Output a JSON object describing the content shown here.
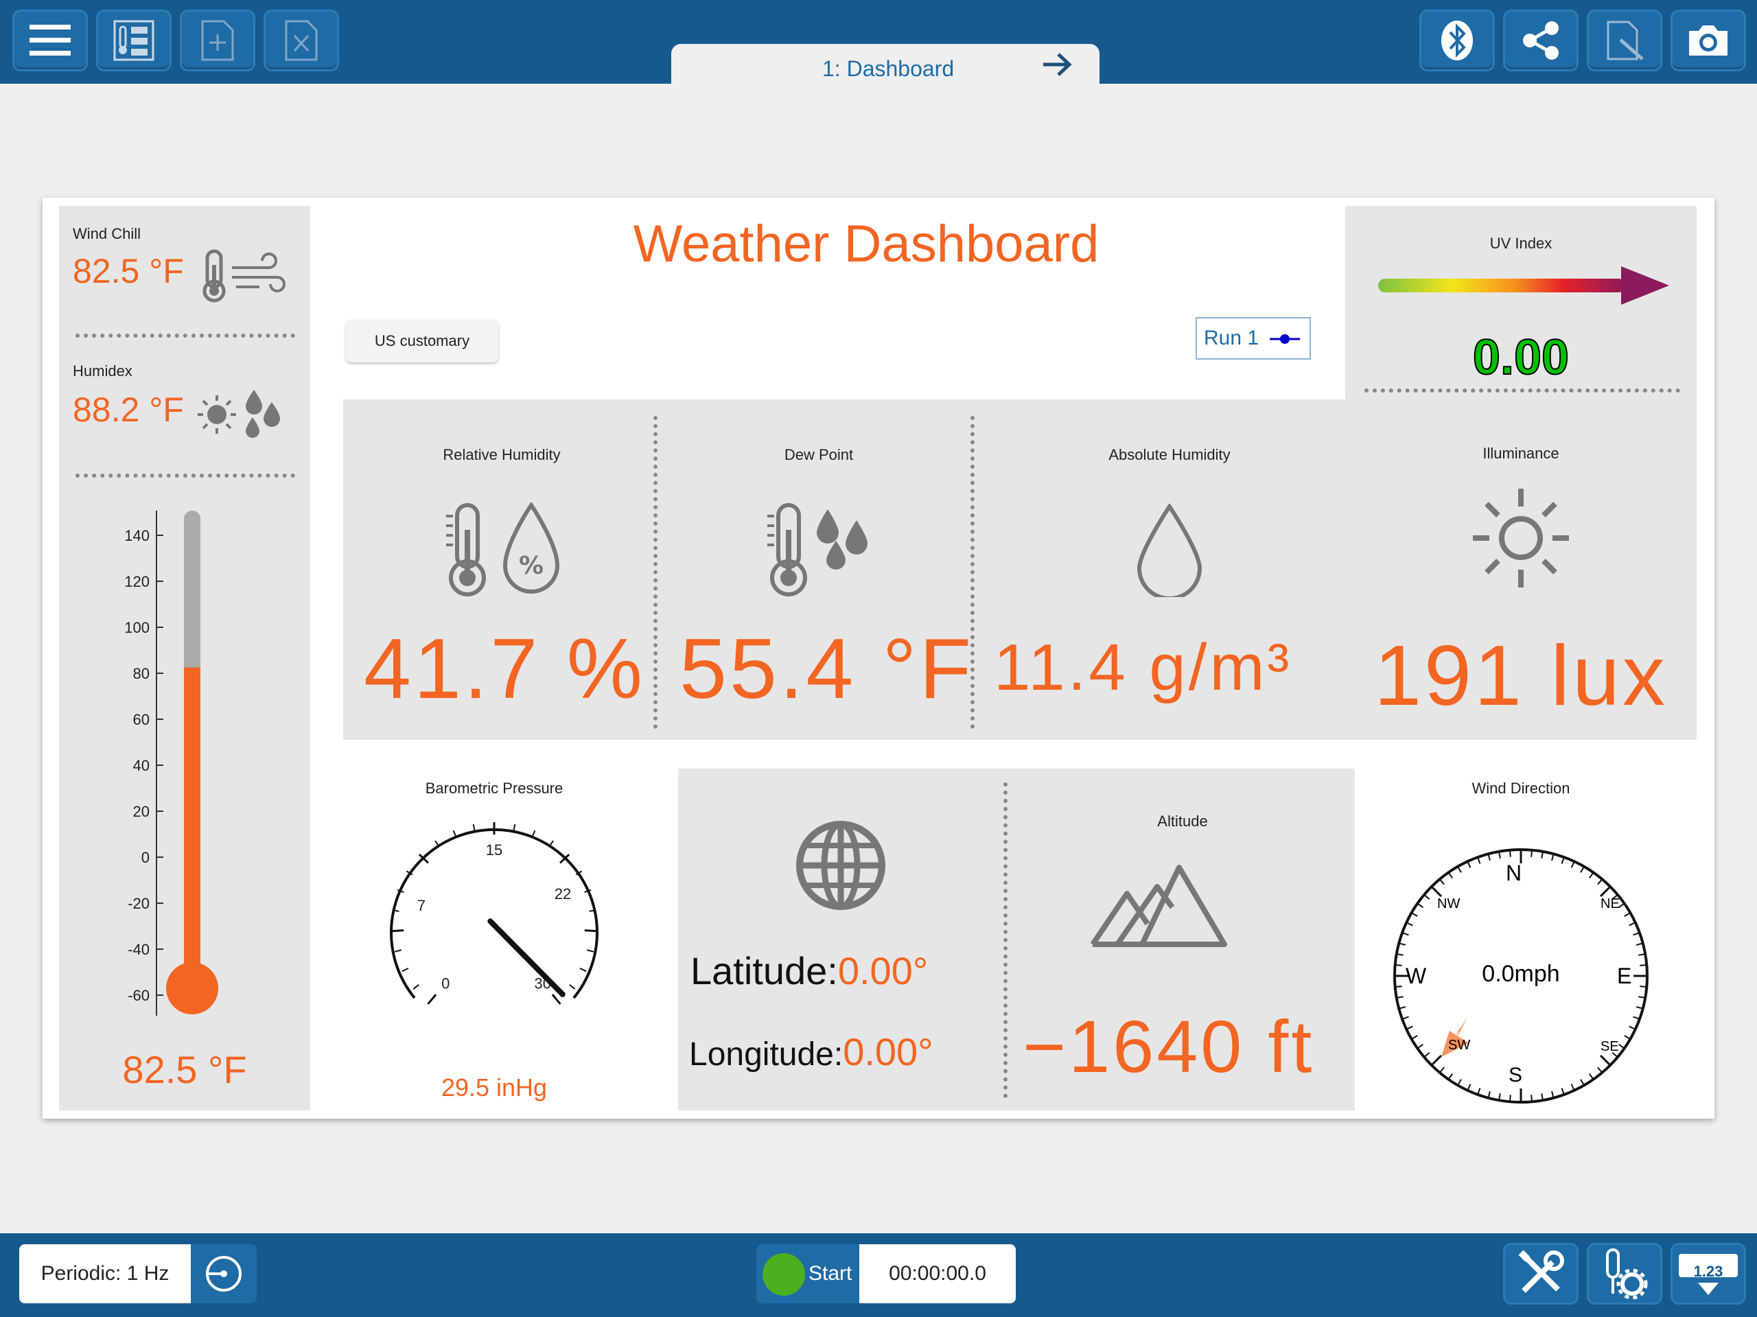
{
  "tab": {
    "label": "1: Dashboard"
  },
  "title": "Weather Dashboard",
  "units_button": "US customary",
  "run": {
    "label": "Run 1"
  },
  "wind_chill": {
    "label": "Wind Chill",
    "value": "82.5 °F"
  },
  "humidex": {
    "label": "Humidex",
    "value": "88.2 °F"
  },
  "thermometer": {
    "value": "82.5 °F",
    "ticks": [
      "140",
      "120",
      "100",
      "80",
      "60",
      "40",
      "20",
      "0",
      "-20",
      "-40",
      "-60"
    ],
    "level": 82.5
  },
  "relative_humidity": {
    "label": "Relative Humidity",
    "value": "41.7 %"
  },
  "dew_point": {
    "label": "Dew Point",
    "value": "55.4 °F"
  },
  "absolute_humidity": {
    "label": "Absolute Humidity",
    "value": "11.4 g/m³"
  },
  "uv_index": {
    "label": "UV Index",
    "value": "0.00"
  },
  "illuminance": {
    "label": "Illuminance",
    "value": "191 lux"
  },
  "barometric": {
    "label": "Barometric Pressure",
    "value": "29.5 inHg",
    "ticks": [
      "0",
      "7",
      "15",
      "22",
      "30"
    ],
    "reading": 29.5
  },
  "location": {
    "latitude_label": "Latitude:",
    "latitude_value": "0.00°",
    "longitude_label": "Longitude:",
    "longitude_value": "0.00°"
  },
  "altitude": {
    "label": "Altitude",
    "value": "−1640 ft"
  },
  "wind_direction": {
    "label": "Wind Direction",
    "speed": "0.0mph",
    "points": {
      "n": "N",
      "ne": "NE",
      "e": "E",
      "se": "SE",
      "s": "S",
      "sw": "SW",
      "w": "W",
      "nw": "NW"
    }
  },
  "bottom": {
    "mode": "Periodic: 1 Hz",
    "start": "Start",
    "time": "00:00:00.0",
    "meter_label": "1.23"
  },
  "colors": {
    "accent": "#f26522",
    "bar": "#165a8d",
    "uv_value": "#00c000"
  }
}
